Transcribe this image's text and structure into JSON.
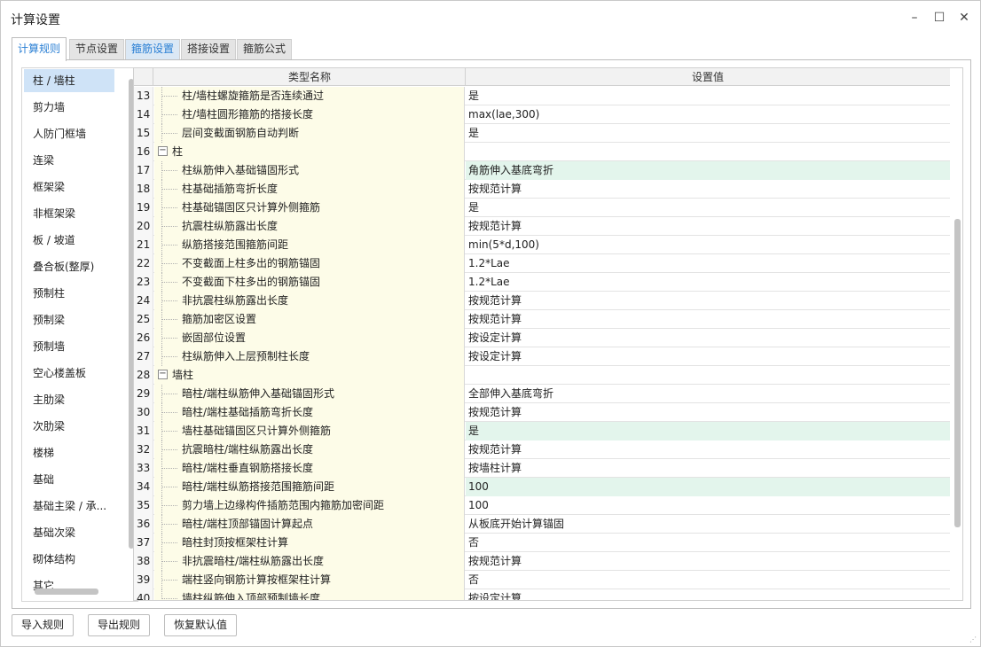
{
  "window": {
    "title": "计算设置"
  },
  "window_controls": {
    "minimize": "–",
    "maximize": "☐",
    "close": "✕"
  },
  "tabs": [
    {
      "label": "计算规则"
    },
    {
      "label": "节点设置"
    },
    {
      "label": "箍筋设置"
    },
    {
      "label": "搭接设置"
    },
    {
      "label": "箍筋公式"
    }
  ],
  "active_tab": "计算规则",
  "sidebar": {
    "items": [
      {
        "label": "柱 / 墙柱"
      },
      {
        "label": "剪力墙"
      },
      {
        "label": "人防门框墙"
      },
      {
        "label": "连梁"
      },
      {
        "label": "框架梁"
      },
      {
        "label": "非框架梁"
      },
      {
        "label": "板 / 坡道"
      },
      {
        "label": "叠合板(整厚)"
      },
      {
        "label": "预制柱"
      },
      {
        "label": "预制梁"
      },
      {
        "label": "预制墙"
      },
      {
        "label": "空心楼盖板"
      },
      {
        "label": "主肋梁"
      },
      {
        "label": "次肋梁"
      },
      {
        "label": "楼梯"
      },
      {
        "label": "基础"
      },
      {
        "label": "基础主梁 / 承..."
      },
      {
        "label": "基础次梁"
      },
      {
        "label": "砌体结构"
      },
      {
        "label": "其它"
      }
    ],
    "selected": "柱 / 墙柱"
  },
  "grid": {
    "columns": [
      "类型名称",
      "设置值"
    ],
    "rows": [
      {
        "num": "13",
        "name": "柱/墙柱螺旋箍筋是否连续通过",
        "value": "是"
      },
      {
        "num": "14",
        "name": "柱/墙柱圆形箍筋的搭接长度",
        "value": "max(lae,300)"
      },
      {
        "num": "15",
        "name": "层间变截面钢筋自动判断",
        "value": "是"
      },
      {
        "num": "16",
        "name": "柱",
        "value": "",
        "group": true
      },
      {
        "num": "17",
        "name": "柱纵筋伸入基础锚固形式",
        "value": "角筋伸入基底弯折",
        "highlight": true
      },
      {
        "num": "18",
        "name": "柱基础插筋弯折长度",
        "value": "按规范计算"
      },
      {
        "num": "19",
        "name": "柱基础锚固区只计算外侧箍筋",
        "value": "是"
      },
      {
        "num": "20",
        "name": "抗震柱纵筋露出长度",
        "value": "按规范计算"
      },
      {
        "num": "21",
        "name": "纵筋搭接范围箍筋间距",
        "value": "min(5*d,100)"
      },
      {
        "num": "22",
        "name": "不变截面上柱多出的钢筋锚固",
        "value": "1.2*Lae"
      },
      {
        "num": "23",
        "name": "不变截面下柱多出的钢筋锚固",
        "value": "1.2*Lae"
      },
      {
        "num": "24",
        "name": "非抗震柱纵筋露出长度",
        "value": "按规范计算"
      },
      {
        "num": "25",
        "name": "箍筋加密区设置",
        "value": "按规范计算"
      },
      {
        "num": "26",
        "name": "嵌固部位设置",
        "value": "按设定计算"
      },
      {
        "num": "27",
        "name": "柱纵筋伸入上层预制柱长度",
        "value": "按设定计算"
      },
      {
        "num": "28",
        "name": "墙柱",
        "value": "",
        "group": true
      },
      {
        "num": "29",
        "name": "暗柱/端柱纵筋伸入基础锚固形式",
        "value": "全部伸入基底弯折"
      },
      {
        "num": "30",
        "name": "暗柱/端柱基础插筋弯折长度",
        "value": "按规范计算"
      },
      {
        "num": "31",
        "name": "墙柱基础锚固区只计算外侧箍筋",
        "value": "是",
        "highlight": true
      },
      {
        "num": "32",
        "name": "抗震暗柱/端柱纵筋露出长度",
        "value": "按规范计算"
      },
      {
        "num": "33",
        "name": "暗柱/端柱垂直钢筋搭接长度",
        "value": "按墙柱计算"
      },
      {
        "num": "34",
        "name": "暗柱/端柱纵筋搭接范围箍筋间距",
        "value": "100",
        "highlight": true
      },
      {
        "num": "35",
        "name": "剪力墙上边缘构件插筋范围内箍筋加密间距",
        "value": "100"
      },
      {
        "num": "36",
        "name": "暗柱/端柱顶部锚固计算起点",
        "value": "从板底开始计算锚固"
      },
      {
        "num": "37",
        "name": "暗柱封顶按框架柱计算",
        "value": "否"
      },
      {
        "num": "38",
        "name": "非抗震暗柱/端柱纵筋露出长度",
        "value": "按规范计算"
      },
      {
        "num": "39",
        "name": "端柱竖向钢筋计算按框架柱计算",
        "value": "否"
      },
      {
        "num": "40",
        "name": "墙柱纵筋伸入顶部预制墙长度",
        "value": "按设定计算"
      }
    ]
  },
  "buttons": {
    "import": "导入规则",
    "export": "导出规则",
    "restore": "恢复默认值"
  }
}
